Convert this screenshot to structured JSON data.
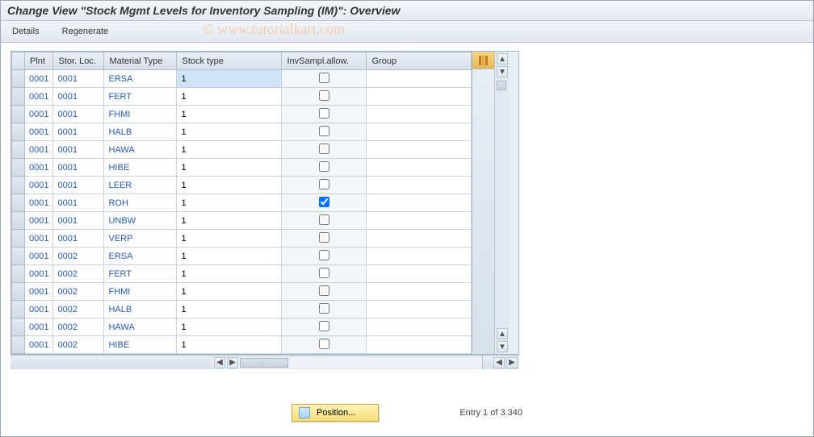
{
  "title": "Change View \"Stock Mgmt Levels for Inventory Sampling (IM)\": Overview",
  "watermark": "© www.tutorialkart.com",
  "toolbar": {
    "details": "Details",
    "regenerate": "Regenerate"
  },
  "columns": {
    "plnt": "Plnt",
    "stor": "Stor. Loc.",
    "mat": "Material Type",
    "stock": "Stock type",
    "invs": "InvSampl.allow.",
    "group": "Group"
  },
  "rows": [
    {
      "plnt": "0001",
      "stor": "0001",
      "mat": "ERSA",
      "stock": "1",
      "allow": false,
      "group": "",
      "sel": true
    },
    {
      "plnt": "0001",
      "stor": "0001",
      "mat": "FERT",
      "stock": "1",
      "allow": false,
      "group": ""
    },
    {
      "plnt": "0001",
      "stor": "0001",
      "mat": "FHMI",
      "stock": "1",
      "allow": false,
      "group": ""
    },
    {
      "plnt": "0001",
      "stor": "0001",
      "mat": "HALB",
      "stock": "1",
      "allow": false,
      "group": ""
    },
    {
      "plnt": "0001",
      "stor": "0001",
      "mat": "HAWA",
      "stock": "1",
      "allow": false,
      "group": ""
    },
    {
      "plnt": "0001",
      "stor": "0001",
      "mat": "HIBE",
      "stock": "1",
      "allow": false,
      "group": ""
    },
    {
      "plnt": "0001",
      "stor": "0001",
      "mat": "LEER",
      "stock": "1",
      "allow": false,
      "group": ""
    },
    {
      "plnt": "0001",
      "stor": "0001",
      "mat": "ROH",
      "stock": "1",
      "allow": true,
      "group": ""
    },
    {
      "plnt": "0001",
      "stor": "0001",
      "mat": "UNBW",
      "stock": "1",
      "allow": false,
      "group": ""
    },
    {
      "plnt": "0001",
      "stor": "0001",
      "mat": "VERP",
      "stock": "1",
      "allow": false,
      "group": ""
    },
    {
      "plnt": "0001",
      "stor": "0002",
      "mat": "ERSA",
      "stock": "1",
      "allow": false,
      "group": ""
    },
    {
      "plnt": "0001",
      "stor": "0002",
      "mat": "FERT",
      "stock": "1",
      "allow": false,
      "group": ""
    },
    {
      "plnt": "0001",
      "stor": "0002",
      "mat": "FHMI",
      "stock": "1",
      "allow": false,
      "group": ""
    },
    {
      "plnt": "0001",
      "stor": "0002",
      "mat": "HALB",
      "stock": "1",
      "allow": false,
      "group": ""
    },
    {
      "plnt": "0001",
      "stor": "0002",
      "mat": "HAWA",
      "stock": "1",
      "allow": false,
      "group": ""
    },
    {
      "plnt": "0001",
      "stor": "0002",
      "mat": "HIBE",
      "stock": "1",
      "allow": false,
      "group": ""
    }
  ],
  "footer": {
    "position_label": "Position...",
    "entry_text": "Entry 1 of 3.340"
  }
}
